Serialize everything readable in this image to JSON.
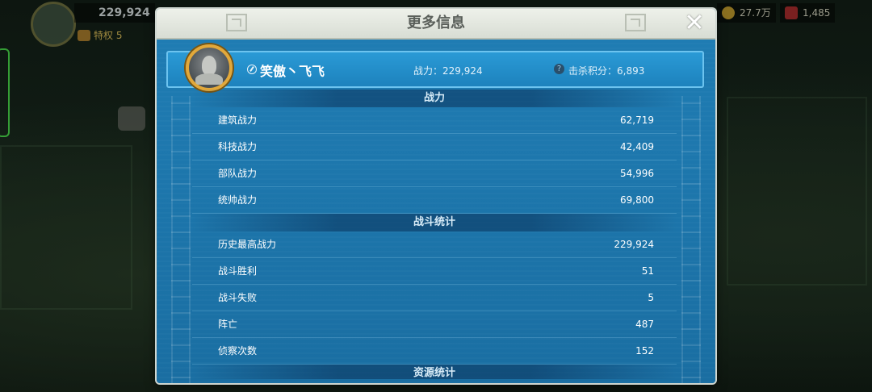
{
  "hud": {
    "player_power": "229,924",
    "vip_label": "特权 5",
    "resource_gold": "27.7万",
    "resource_gems": "1,485"
  },
  "modal": {
    "title": "更多信息",
    "close_icon": "close-icon",
    "player": {
      "name": "笑傲丶飞飞",
      "power_text": "战力：229,924",
      "kill_points_text": "击杀积分：6,893"
    },
    "sections": [
      {
        "title": "战力",
        "rows": [
          {
            "label": "建筑战力",
            "value": "62,719"
          },
          {
            "label": "科技战力",
            "value": "42,409"
          },
          {
            "label": "部队战力",
            "value": "54,996"
          },
          {
            "label": "统帅战力",
            "value": "69,800"
          }
        ]
      },
      {
        "title": "战斗统计",
        "rows": [
          {
            "label": "历史最高战力",
            "value": "229,924"
          },
          {
            "label": "战斗胜利",
            "value": "51"
          },
          {
            "label": "战斗失败",
            "value": "5"
          },
          {
            "label": "阵亡",
            "value": "487"
          },
          {
            "label": "侦察次数",
            "value": "152"
          }
        ]
      },
      {
        "title": "资源统计",
        "rows": []
      }
    ]
  },
  "colors": {
    "modal_blue": "#1a6fa4",
    "banner_blue": "#2a9ad6",
    "avatar_ring": "#e2a83a"
  }
}
